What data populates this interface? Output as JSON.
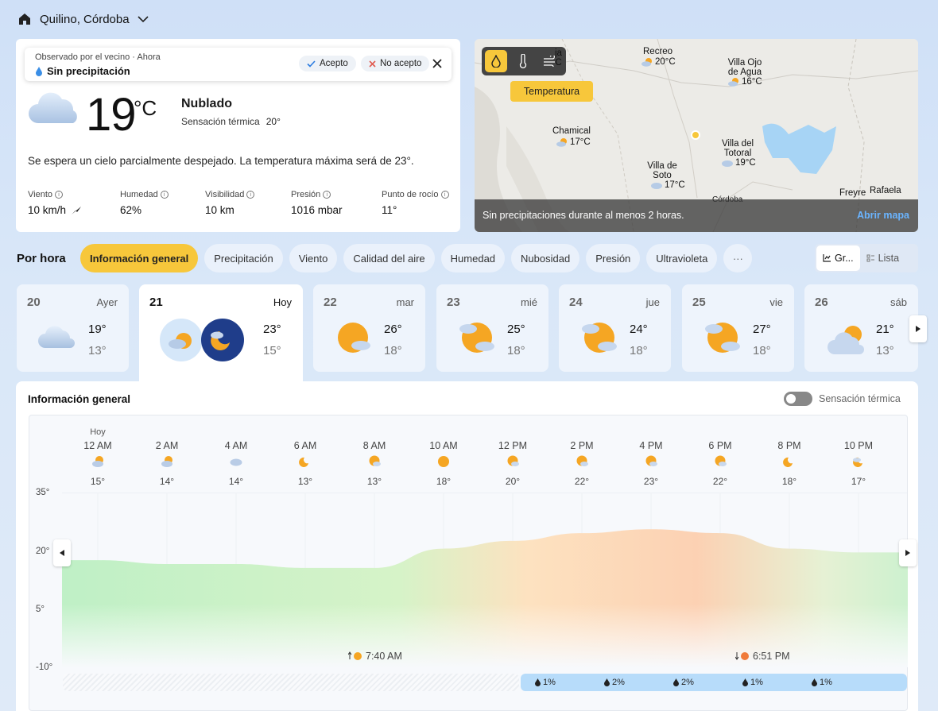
{
  "location": {
    "name": "Quilino, Córdoba"
  },
  "observation": {
    "source": "Observado por el vecino · Ahora",
    "status": "Sin precipitación",
    "accept": "Acepto",
    "reject": "No acepto"
  },
  "current": {
    "temp": "19",
    "unit": "°C",
    "condition": "Nublado",
    "feels_label": "Sensación térmica",
    "feels_value": "20°",
    "forecast": "Se espera un cielo parcialmente despejado. La temperatura máxima será de 23°.",
    "metrics": [
      {
        "label": "Viento",
        "value": "10 km/h"
      },
      {
        "label": "Humedad",
        "value": "62%"
      },
      {
        "label": "Visibilidad",
        "value": "10 km"
      },
      {
        "label": "Presión",
        "value": "1016 mbar"
      },
      {
        "label": "Punto de rocío",
        "value": "11°"
      }
    ]
  },
  "map": {
    "layer": "Temperatura",
    "footer_text": "Sin precipitaciones durante al menos 2 horas.",
    "open_link": "Abrir mapa",
    "places": [
      {
        "name": "Recreo",
        "temp": "20°C"
      },
      {
        "name": "Villa Ojo de Agua",
        "temp": "16°C"
      },
      {
        "name": "Chamical",
        "temp": "17°C"
      },
      {
        "name": "Villa del Totoral",
        "temp": "19°C"
      },
      {
        "name": "Villa de Soto",
        "temp": "17°C"
      },
      {
        "name": "Freyre",
        "temp": ""
      },
      {
        "name": "Rafaela",
        "temp": ""
      },
      {
        "name": "Córdoba",
        "temp": ""
      }
    ],
    "partial_top_left": "ja",
    "partial_top_left_temp": "C"
  },
  "hourly": {
    "label": "Por hora",
    "tabs": [
      "Información general",
      "Precipitación",
      "Viento",
      "Calidad del aire",
      "Humedad",
      "Nubosidad",
      "Presión",
      "Ultravioleta",
      "···"
    ],
    "view_graph": "Gr...",
    "view_list": "Lista"
  },
  "days": [
    {
      "num": "20",
      "name": "Ayer",
      "hi": "19°",
      "lo": "13°",
      "icon": "cloudy-icon"
    },
    {
      "num": "21",
      "name": "Hoy",
      "hi": "23°",
      "lo": "15°",
      "icon": "partly-cloudy-night-icon"
    },
    {
      "num": "22",
      "name": "mar",
      "hi": "26°",
      "lo": "18°",
      "icon": "sun-cloud-icon"
    },
    {
      "num": "23",
      "name": "mié",
      "hi": "25°",
      "lo": "18°",
      "icon": "sun-clouds-icon"
    },
    {
      "num": "24",
      "name": "jue",
      "hi": "24°",
      "lo": "18°",
      "icon": "sun-clouds-icon"
    },
    {
      "num": "25",
      "name": "vie",
      "hi": "27°",
      "lo": "18°",
      "icon": "sun-clouds-icon"
    },
    {
      "num": "26",
      "name": "sáb",
      "hi": "21°",
      "lo": "13°",
      "icon": "cloud-sun-icon"
    }
  ],
  "panel": {
    "title": "Información general",
    "toggle_label": "Sensación térmica",
    "today_label": "Hoy",
    "sunrise": "7:40 AM",
    "sunset": "6:51 PM"
  },
  "chart_data": {
    "type": "area",
    "x": [
      "12 AM",
      "2 AM",
      "4 AM",
      "6 AM",
      "8 AM",
      "10 AM",
      "12 PM",
      "2 PM",
      "4 PM",
      "6 PM",
      "8 PM",
      "10 PM"
    ],
    "series": [
      {
        "values": [
          15,
          14,
          14,
          13,
          13,
          18,
          20,
          22,
          23,
          22,
          18,
          17
        ]
      }
    ],
    "y_ticks": [
      "35°",
      "20°",
      "5°",
      "-10°"
    ],
    "ylim": [
      -10,
      35
    ],
    "hour_icons": [
      "partly-cloudy-night-icon",
      "partly-cloudy-night-icon",
      "cloud-icon",
      "moon-icon",
      "sun-cloud-icon",
      "sun-icon",
      "sun-cloud-icon",
      "sun-cloud-icon",
      "sun-cloud-icon",
      "sun-cloud-icon",
      "moon-icon",
      "moon-cloud-icon"
    ],
    "precip": [
      "1%",
      "2%",
      "2%",
      "1%",
      "1%"
    ]
  }
}
